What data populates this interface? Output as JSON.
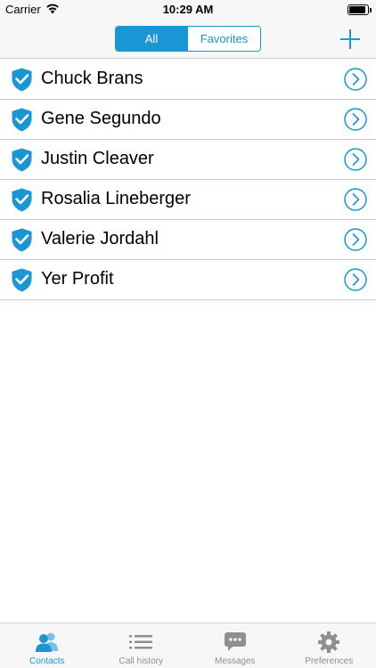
{
  "status_bar": {
    "carrier": "Carrier",
    "time": "10:29 AM",
    "battery_level": 0.9
  },
  "nav": {
    "segments": [
      {
        "label": "All",
        "selected": true
      },
      {
        "label": "Favorites",
        "selected": false
      }
    ],
    "add_icon": "plus-icon"
  },
  "contacts": [
    {
      "name": "Chuck Brans",
      "icon": "shield-check-icon"
    },
    {
      "name": "Gene Segundo",
      "icon": "shield-check-icon"
    },
    {
      "name": "Justin Cleaver",
      "icon": "shield-check-icon"
    },
    {
      "name": "Rosalia Lineberger",
      "icon": "shield-check-icon"
    },
    {
      "name": "Valerie Jordahl",
      "icon": "shield-check-icon"
    },
    {
      "name": "Yer Profit",
      "icon": "shield-check-icon"
    }
  ],
  "tab_bar": {
    "tabs": [
      {
        "label": "Contacts",
        "icon": "contacts-icon",
        "active": true
      },
      {
        "label": "Call history",
        "icon": "list-icon",
        "active": false
      },
      {
        "label": "Messages",
        "icon": "chat-bubble-icon",
        "active": false
      },
      {
        "label": "Preferences",
        "icon": "gear-icon",
        "active": false
      }
    ]
  },
  "colors": {
    "accent": "#1a96d4",
    "inactive": "#8e8e93",
    "bar_background": "#f7f7f7",
    "separator": "#c8c8cc"
  }
}
